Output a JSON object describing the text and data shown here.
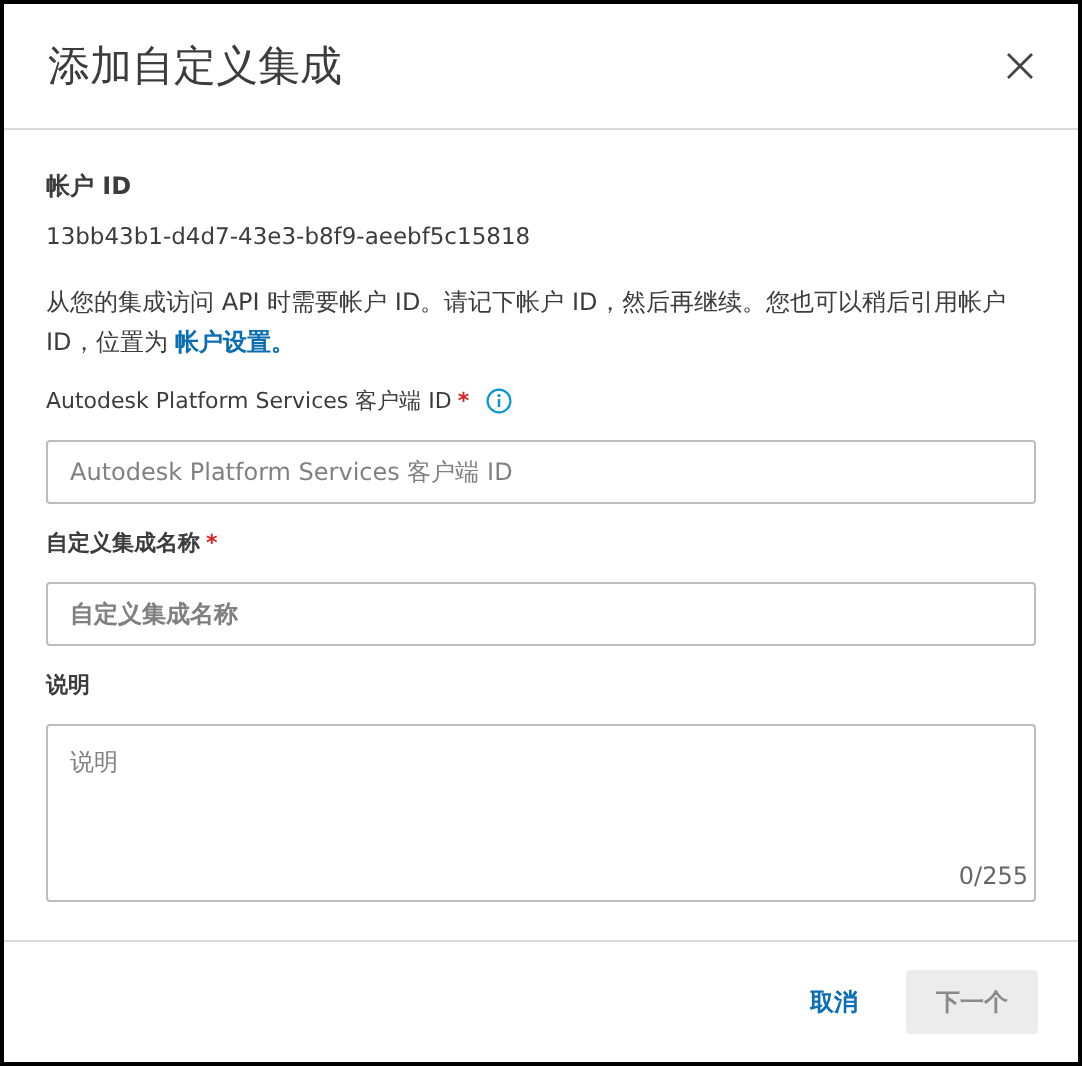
{
  "dialog": {
    "title": "添加自定义集成"
  },
  "account": {
    "label": "帐户 ID",
    "value": "13bb43b1-d4d7-43e3-b8f9-aeebf5c15818"
  },
  "note": {
    "text": "从您的集成访问 API 时需要帐户 ID。请记下帐户 ID，然后再继续。您也可以稍后引用帐户 ID，位置为 ",
    "link": "帐户设置。"
  },
  "fields": [
    {
      "kind": "input",
      "label": "Autodesk Platform Services 客户端 ID",
      "required_mark": "*",
      "info": true,
      "placeholder": "Autodesk Platform Services 客户端 ID"
    },
    {
      "kind": "input",
      "label": "自定义集成名称",
      "required_mark": "*",
      "placeholder": "自定义集成名称"
    },
    {
      "kind": "textarea",
      "label": "说明",
      "placeholder": "说明",
      "counter": "0/255"
    }
  ],
  "buttons": [
    {
      "label": "取消",
      "kind": "link"
    },
    {
      "label": "下一个",
      "kind": "primary",
      "disabled": true
    }
  ]
}
